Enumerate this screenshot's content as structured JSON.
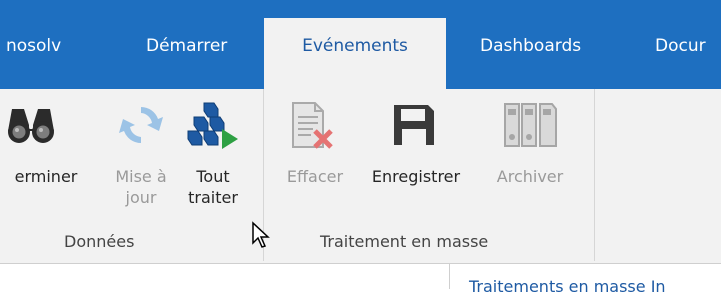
{
  "tabs": [
    {
      "label": "nosolv"
    },
    {
      "label": "Démarrer"
    },
    {
      "label": "Evénements",
      "active": true
    },
    {
      "label": "Dashboards"
    },
    {
      "label": "Docur"
    }
  ],
  "ribbon": {
    "buttons": {
      "determiner": {
        "label": "erminer"
      },
      "mise_a_jour": {
        "line1": "Mise à",
        "line2": "jour"
      },
      "tout_traiter": {
        "line1": "Tout",
        "line2": "traiter"
      },
      "effacer": {
        "label": "Effacer"
      },
      "enregistrer": {
        "label": "Enregistrer"
      },
      "archiver": {
        "label": "Archiver"
      }
    },
    "groups": {
      "donnees": "Données",
      "traitement": "Traitement en masse"
    }
  },
  "bottom": {
    "right_text": "Traitements en masse In"
  },
  "colors": {
    "tabbar": "#1e6fc0",
    "active_tab_bg": "#f2f2f2",
    "active_tab_text": "#1e5aa3",
    "ribbon_bg": "#f2f2f2"
  },
  "icons": {
    "determiner": "binoculars-icon",
    "mise_a_jour": "refresh-icon",
    "tout_traiter": "cubes-play-icon",
    "effacer": "document-delete-icon",
    "enregistrer": "save-icon",
    "archiver": "archive-binders-icon"
  }
}
